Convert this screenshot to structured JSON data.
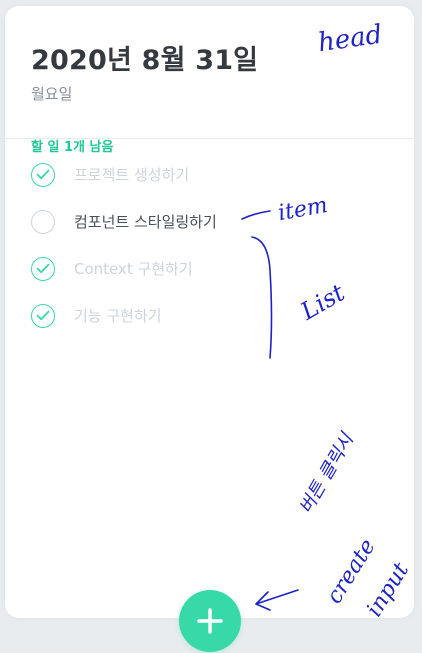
{
  "head": {
    "date": "2020년 8월 31일",
    "day": "월요일",
    "tasks_left": "할 일 1개 남음"
  },
  "list": {
    "items": [
      {
        "text": "프로젝트 생성하기",
        "done": true
      },
      {
        "text": "컴포넌트 스타일링하기",
        "done": false
      },
      {
        "text": "Context 구현하기",
        "done": true
      },
      {
        "text": "기능 구현하기",
        "done": true
      }
    ]
  },
  "create": {
    "icon": "plus-icon"
  },
  "annotations": {
    "head": "head",
    "item": "item",
    "list": "List",
    "create_korean": "버튼 클릭시",
    "create_1": "create",
    "create_2": "input"
  },
  "colors": {
    "accent": "#38d9a9",
    "tasks_left": "#20c997",
    "annotation_ink": "#1d23c7"
  }
}
